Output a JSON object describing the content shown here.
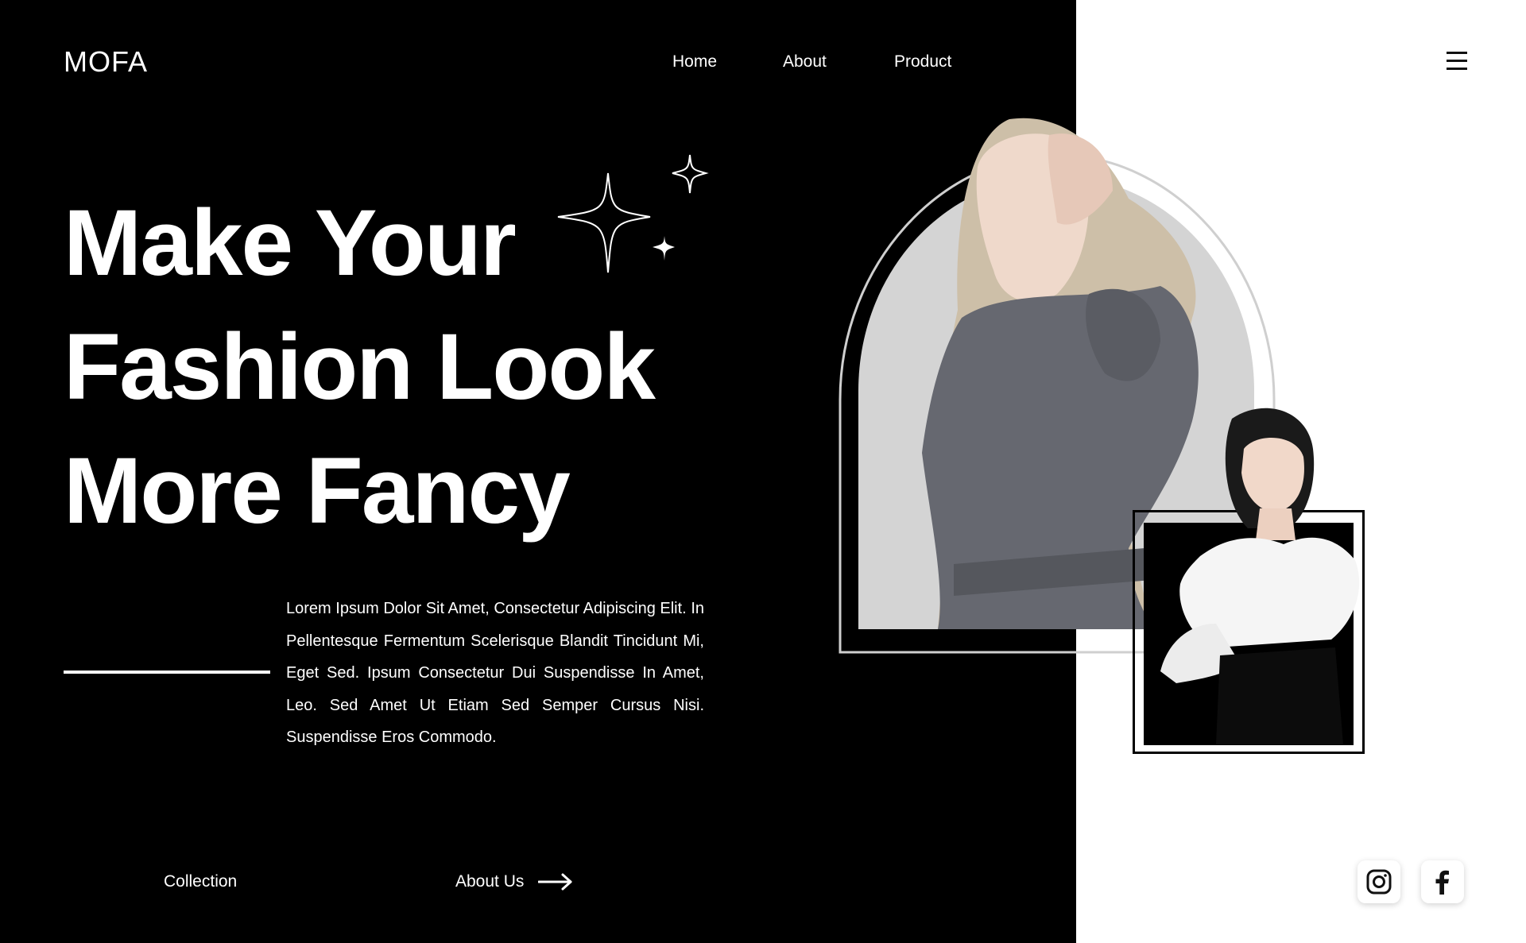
{
  "brand": {
    "logo": "MOFA"
  },
  "nav": {
    "items": [
      {
        "label": "Home"
      },
      {
        "label": "About"
      },
      {
        "label": "Product"
      }
    ],
    "menu_icon": "hamburger-menu-icon"
  },
  "hero": {
    "headline_lines": [
      "Make Your",
      "Fashion Look",
      "More Fancy"
    ],
    "description": "Lorem Ipsum Dolor Sit Amet, Consectetur Adipiscing Elit. In Pellentesque Fermentum Scelerisque Blandit Tincidunt Mi, Eget Sed. Ipsum Consectetur Dui Suspendisse In Amet, Leo. Sed Amet Ut Etiam Sed Semper Cursus Nisi. Suspendisse Eros Commodo.",
    "decoration_icon": "sparkles-icon"
  },
  "bottom_links": {
    "collection": "Collection",
    "about_us": "About Us",
    "about_us_icon": "arrow-right-icon"
  },
  "social": {
    "items": [
      {
        "icon": "instagram-icon"
      },
      {
        "icon": "facebook-icon"
      }
    ]
  },
  "colors": {
    "panel": "#000000",
    "background": "#ffffff",
    "arch_fill": "#d4d4d4",
    "arch_outline": "#cfcfcf",
    "text_light": "#ffffff"
  }
}
